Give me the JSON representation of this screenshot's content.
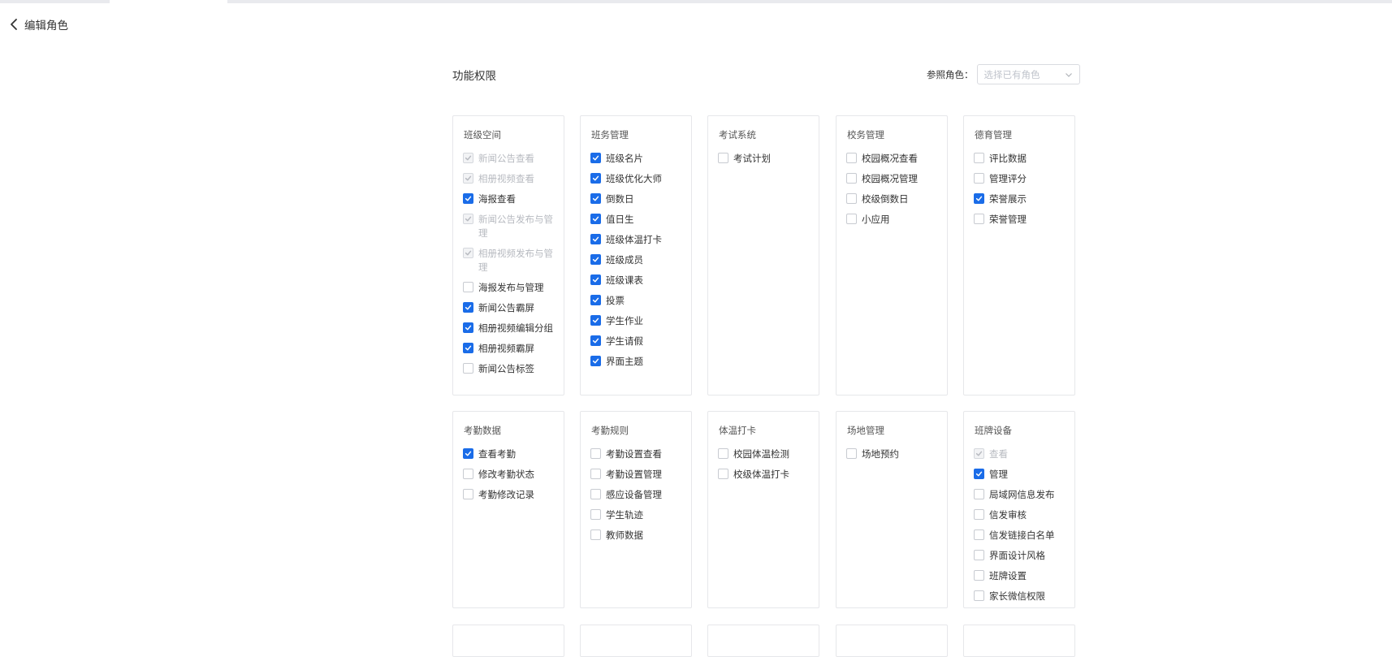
{
  "header": {
    "title": "编辑角色"
  },
  "section": {
    "title": "功能权限"
  },
  "reference": {
    "label": "参照角色：",
    "placeholder": "选择已有角色"
  },
  "cards": [
    {
      "title": "班级空间",
      "items": [
        {
          "label": "新闻公告查看",
          "state": "disabled"
        },
        {
          "label": "相册视频查看",
          "state": "disabled"
        },
        {
          "label": "海报查看",
          "state": "checked"
        },
        {
          "label": "新闻公告发布与管理",
          "state": "disabled"
        },
        {
          "label": "相册视频发布与管理",
          "state": "disabled"
        },
        {
          "label": "海报发布与管理",
          "state": "unchecked"
        },
        {
          "label": "新闻公告霸屏",
          "state": "checked"
        },
        {
          "label": "相册视频编辑分组",
          "state": "checked"
        },
        {
          "label": "相册视频霸屏",
          "state": "checked"
        },
        {
          "label": "新闻公告标签",
          "state": "unchecked"
        }
      ]
    },
    {
      "title": "班务管理",
      "items": [
        {
          "label": "班级名片",
          "state": "checked"
        },
        {
          "label": "班级优化大师",
          "state": "checked"
        },
        {
          "label": "倒数日",
          "state": "checked"
        },
        {
          "label": "值日生",
          "state": "checked"
        },
        {
          "label": "班级体温打卡",
          "state": "checked"
        },
        {
          "label": "班级成员",
          "state": "checked"
        },
        {
          "label": "班级课表",
          "state": "checked"
        },
        {
          "label": "投票",
          "state": "checked"
        },
        {
          "label": "学生作业",
          "state": "checked"
        },
        {
          "label": "学生请假",
          "state": "checked"
        },
        {
          "label": "界面主题",
          "state": "checked"
        }
      ]
    },
    {
      "title": "考试系统",
      "items": [
        {
          "label": "考试计划",
          "state": "unchecked"
        }
      ]
    },
    {
      "title": "校务管理",
      "items": [
        {
          "label": "校园概况查看",
          "state": "unchecked"
        },
        {
          "label": "校园概况管理",
          "state": "unchecked"
        },
        {
          "label": "校级倒数日",
          "state": "unchecked"
        },
        {
          "label": "小应用",
          "state": "unchecked"
        }
      ]
    },
    {
      "title": "德育管理",
      "items": [
        {
          "label": "评比数据",
          "state": "unchecked"
        },
        {
          "label": "管理评分",
          "state": "unchecked"
        },
        {
          "label": "荣誉展示",
          "state": "checked"
        },
        {
          "label": "荣誉管理",
          "state": "unchecked"
        }
      ]
    },
    {
      "title": "考勤数据",
      "items": [
        {
          "label": "查看考勤",
          "state": "checked"
        },
        {
          "label": "修改考勤状态",
          "state": "unchecked"
        },
        {
          "label": "考勤修改记录",
          "state": "unchecked"
        }
      ]
    },
    {
      "title": "考勤规则",
      "items": [
        {
          "label": "考勤设置查看",
          "state": "unchecked"
        },
        {
          "label": "考勤设置管理",
          "state": "unchecked"
        },
        {
          "label": "感应设备管理",
          "state": "unchecked"
        },
        {
          "label": "学生轨迹",
          "state": "unchecked"
        },
        {
          "label": "教师数据",
          "state": "unchecked"
        }
      ]
    },
    {
      "title": "体温打卡",
      "items": [
        {
          "label": "校园体温检测",
          "state": "unchecked"
        },
        {
          "label": "校级体温打卡",
          "state": "unchecked"
        }
      ]
    },
    {
      "title": "场地管理",
      "items": [
        {
          "label": "场地预约",
          "state": "unchecked"
        }
      ]
    },
    {
      "title": "班牌设备",
      "items": [
        {
          "label": "查看",
          "state": "disabled"
        },
        {
          "label": "管理",
          "state": "checked"
        },
        {
          "label": "局域网信息发布",
          "state": "unchecked"
        },
        {
          "label": "信发审核",
          "state": "unchecked"
        },
        {
          "label": "信发链接白名单",
          "state": "unchecked"
        },
        {
          "label": "界面设计风格",
          "state": "unchecked"
        },
        {
          "label": "班牌设置",
          "state": "unchecked"
        },
        {
          "label": "家长微信权限",
          "state": "unchecked"
        }
      ]
    },
    {
      "title": "",
      "items": []
    },
    {
      "title": "",
      "items": []
    },
    {
      "title": "",
      "items": []
    },
    {
      "title": "",
      "items": []
    },
    {
      "title": "",
      "items": []
    }
  ]
}
